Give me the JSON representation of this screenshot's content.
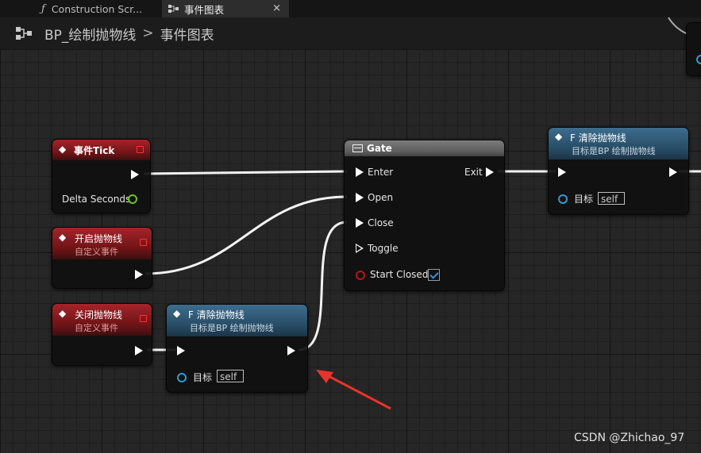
{
  "tabs": [
    {
      "label": "Construction Scr...",
      "icon": "function-icon"
    },
    {
      "label": "事件图表",
      "icon": "event-graph-icon",
      "close": "×"
    }
  ],
  "breadcrumb": {
    "blueprint": "BP_绘制抛物线",
    "separator": ">",
    "graph": "事件图表"
  },
  "nodes": {
    "event_tick": {
      "title": "事件Tick",
      "output": "Delta Seconds"
    },
    "open_event": {
      "title": "开启抛物线",
      "subtitle": "自定义事件"
    },
    "close_event": {
      "title": "关闭抛物线",
      "subtitle": "自定义事件"
    },
    "clear_bottom": {
      "title": "F 清除抛物线",
      "subtitle": "目标是BP 绘制抛物线",
      "target_label": "目标",
      "target_value": "self"
    },
    "gate": {
      "title": "Gate",
      "enter": "Enter",
      "open": "Open",
      "close": "Close",
      "toggle": "Toggle",
      "start_closed": "Start Closed",
      "exit": "Exit",
      "start_closed_checked": true
    },
    "clear_top": {
      "title": "F 清除抛物线",
      "subtitle": "目标是BP 绘制抛物线",
      "target_label": "目标",
      "target_value": "self"
    }
  },
  "annotation": {
    "arrow_color": "#e8332a"
  },
  "colors": {
    "event_header": "#a5242a",
    "function_header": "#3d6d8f",
    "gate_header": "#7c7c7c",
    "float_pin": "#6ec21a",
    "object_pin": "#2c9bd6",
    "bool_pin": "#b81414"
  },
  "watermark": "CSDN @Zhichao_97"
}
